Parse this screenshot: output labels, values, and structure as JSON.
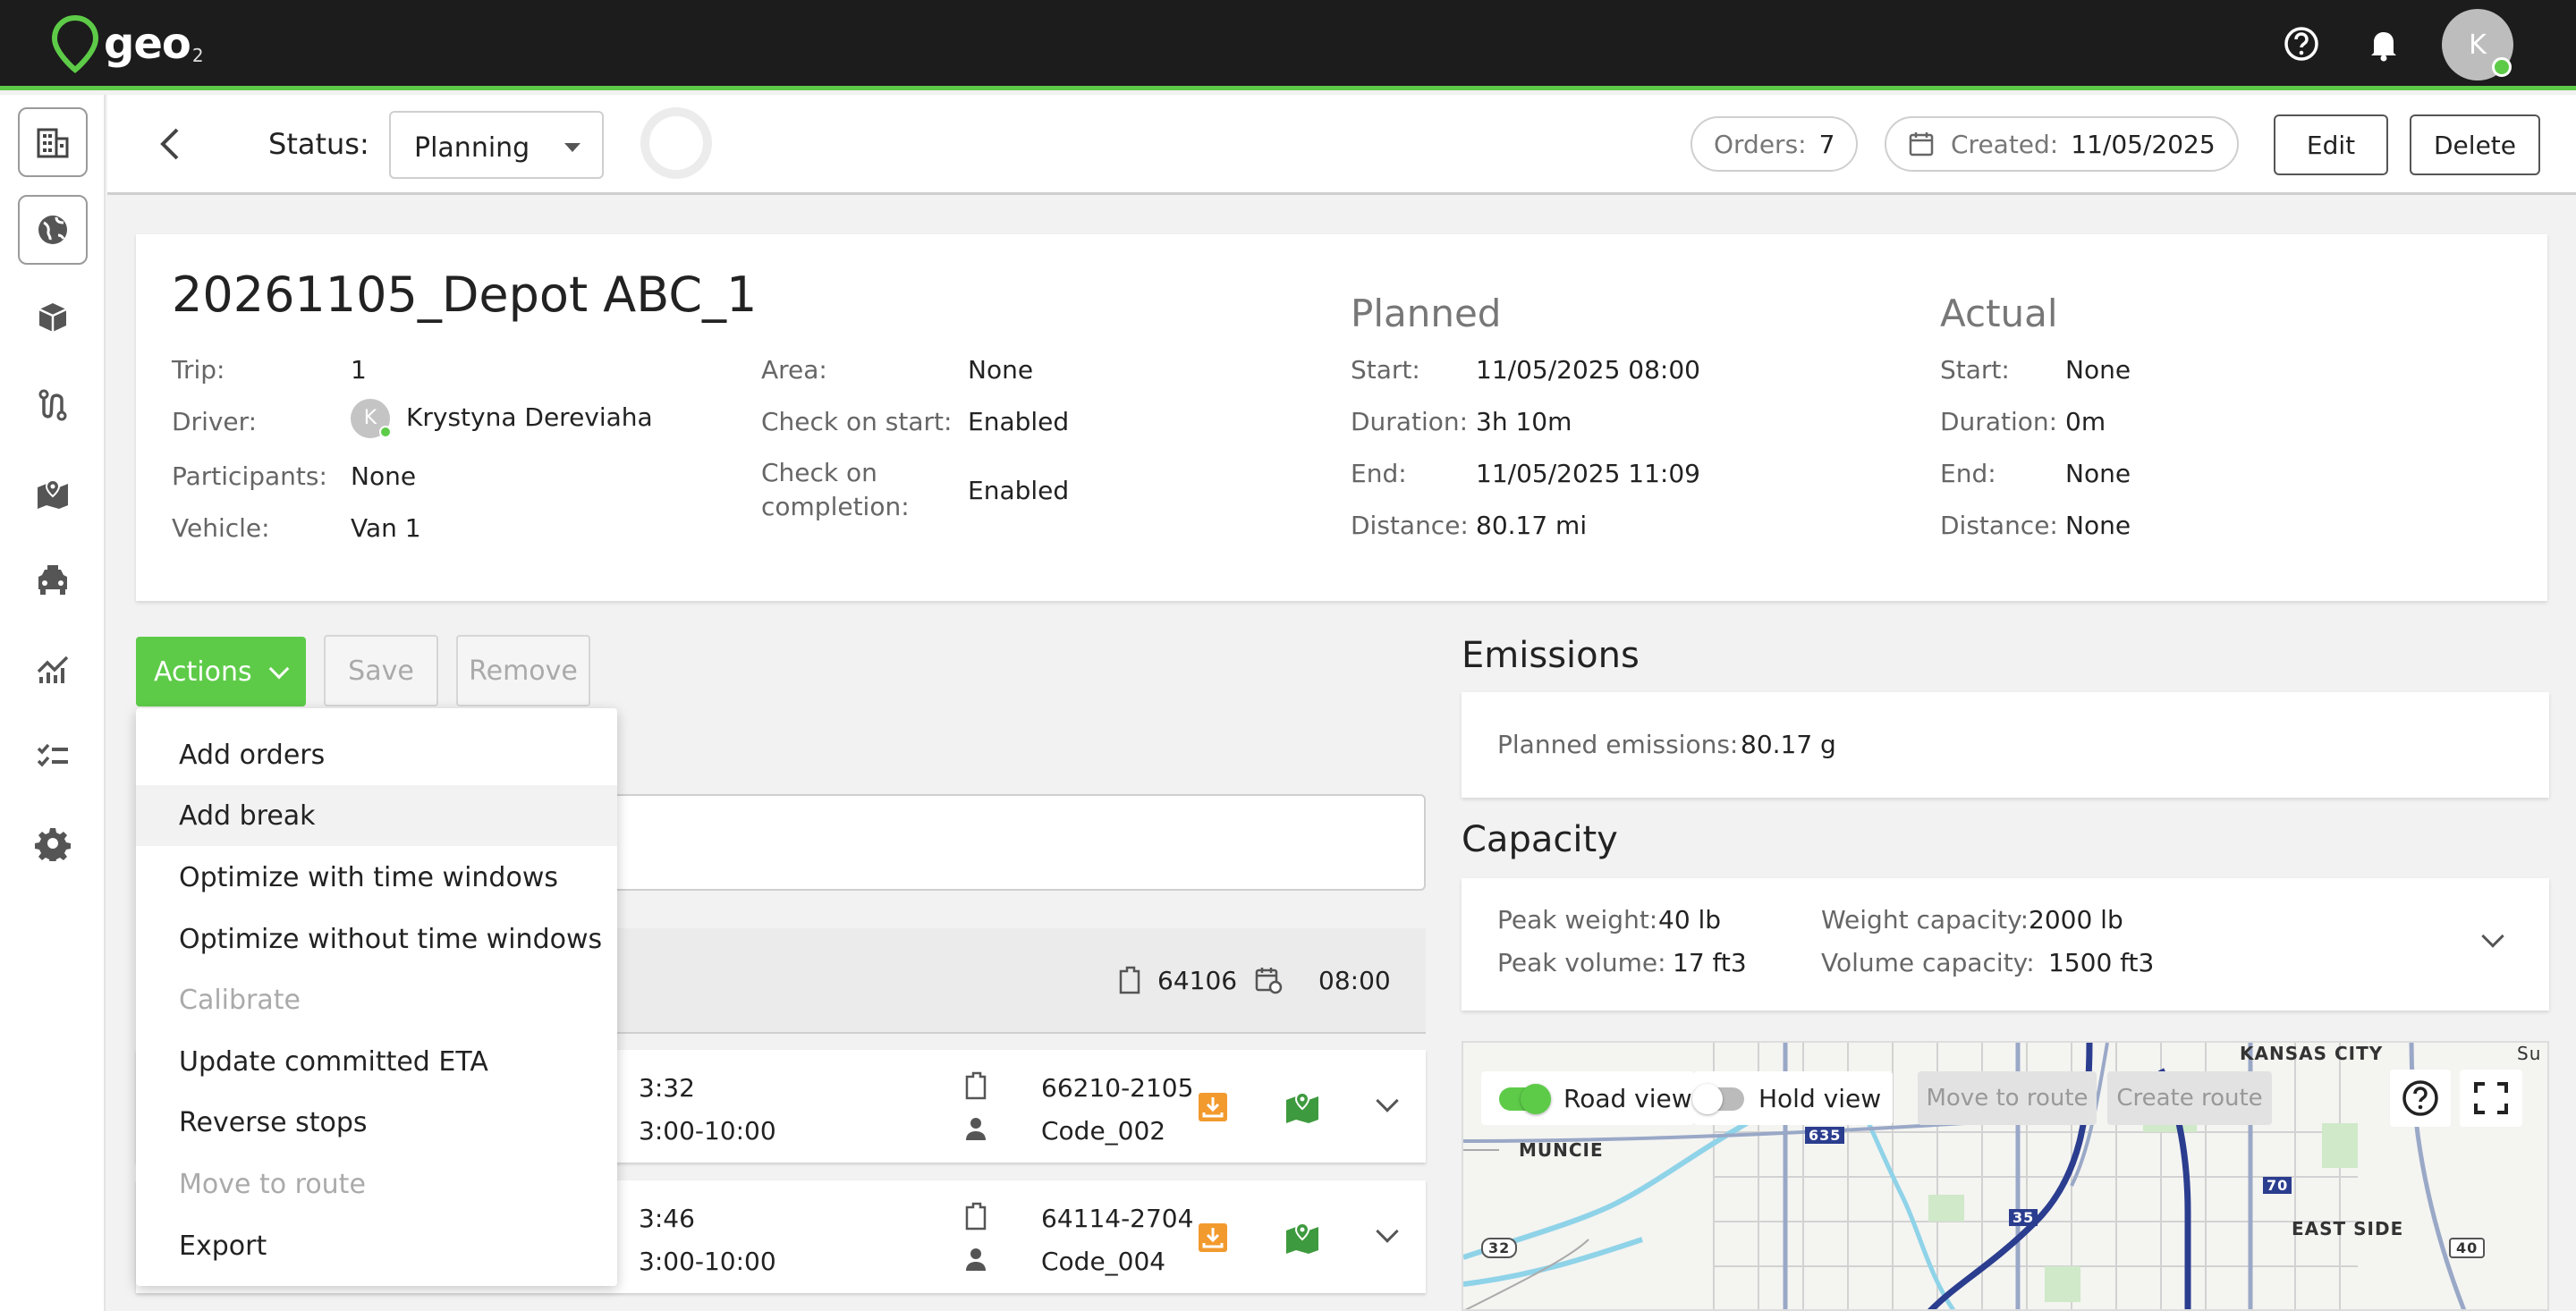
{
  "app": {
    "logo_text": "geo",
    "logo_sub": "2"
  },
  "topbar": {
    "avatar_initial": "K"
  },
  "status_bar": {
    "status_label": "Status:",
    "status_value": "Planning",
    "orders_label": "Orders:",
    "orders_value": "7",
    "created_label": "Created:",
    "created_value": "11/05/2025",
    "edit_label": "Edit",
    "delete_label": "Delete"
  },
  "trip": {
    "title": "20261105_Depot ABC_1",
    "fields": {
      "trip_label": "Trip:",
      "trip_value": "1",
      "driver_label": "Driver:",
      "driver_initial": "K",
      "driver_value": "Krystyna Dereviaha",
      "participants_label": "Participants:",
      "participants_value": "None",
      "vehicle_label": "Vehicle:",
      "vehicle_value": "Van 1",
      "area_label": "Area:",
      "area_value": "None",
      "check_start_label": "Check on start:",
      "check_start_value": "Enabled",
      "check_completion_label_1": "Check on",
      "check_completion_label_2": "completion:",
      "check_completion_value": "Enabled"
    },
    "planned": {
      "heading": "Planned",
      "start_label": "Start:",
      "start_value": "11/05/2025 08:00",
      "duration_label": "Duration:",
      "duration_value": "3h 10m",
      "end_label": "End:",
      "end_value": "11/05/2025 11:09",
      "distance_label": "Distance:",
      "distance_value": "80.17 mi"
    },
    "actual": {
      "heading": "Actual",
      "start_label": "Start:",
      "start_value": "None",
      "duration_label": "Duration:",
      "duration_value": "0m",
      "end_label": "End:",
      "end_value": "None",
      "distance_label": "Distance:",
      "distance_value": "None"
    }
  },
  "toolbar": {
    "actions_label": "Actions",
    "save_label": "Save",
    "remove_label": "Remove"
  },
  "actions_menu": {
    "items": [
      "Add orders",
      "Add break",
      "Optimize with time windows",
      "Optimize without time windows",
      "Calibrate",
      "Update committed ETA",
      "Reverse stops",
      "Move to route",
      "Export"
    ]
  },
  "depot": {
    "code": "64106",
    "time": "08:00"
  },
  "stops": [
    {
      "eta": "3:32",
      "window": "3:00-10:00",
      "zip": "66210-2105",
      "code": "Code_002"
    },
    {
      "eta": "3:46",
      "window": "3:00-10:00",
      "zip": "64114-2704",
      "code": "Code_004"
    }
  ],
  "emissions": {
    "heading": "Emissions",
    "label": "Planned emissions:",
    "value": "80.17 g"
  },
  "capacity": {
    "heading": "Capacity",
    "peak_weight_label": "Peak weight:",
    "peak_weight_value": "40 lb",
    "peak_volume_label": "Peak volume:",
    "peak_volume_value": "17 ft3",
    "weight_capacity_label": "Weight capacity:",
    "weight_capacity_value": "2000 lb",
    "volume_capacity_label": "Volume capacity:",
    "volume_capacity_value": "1500 ft3"
  },
  "map": {
    "road_view_label": "Road view",
    "hold_view_label": "Hold view",
    "move_to_route_label": "Move to route",
    "create_route_label": "Create route",
    "labels": {
      "kansas_city": "KANSAS CITY",
      "muncie": "MUNCIE",
      "east_side": "EAST SIDE",
      "su": "Su",
      "hw635": "635",
      "hw70": "70",
      "hw32": "32",
      "hw40": "40",
      "hw35": "35"
    }
  },
  "colors": {
    "accent": "#5dcb48",
    "topbar": "#1c1c1c",
    "orange": "#f29a2e",
    "route": "#2b3d8f"
  }
}
